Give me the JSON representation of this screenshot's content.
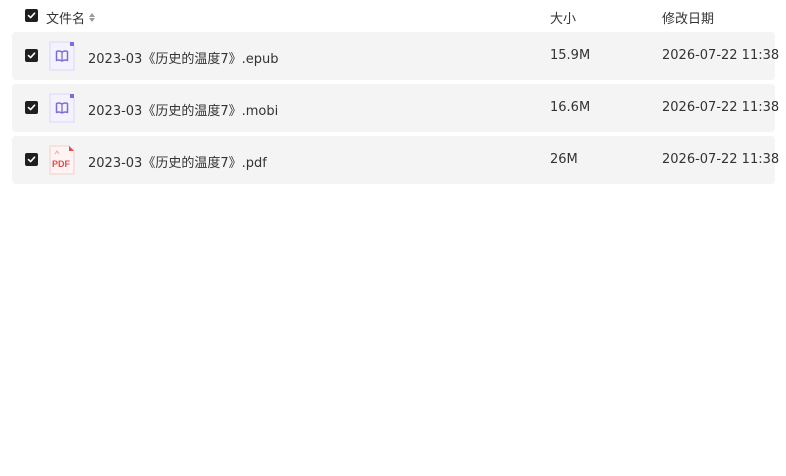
{
  "header": {
    "name_label": "文件名",
    "size_label": "大小",
    "date_label": "修改日期",
    "all_checked": true
  },
  "files": [
    {
      "name": "2023-03《历史的温度7》.epub",
      "size": "15.9M",
      "modified": "2026-07-22 11:38",
      "icon": "ebook-icon",
      "checked": true
    },
    {
      "name": "2023-03《历史的温度7》.mobi",
      "size": "16.6M",
      "modified": "2026-07-22 11:38",
      "icon": "ebook-icon",
      "checked": true
    },
    {
      "name": "2023-03《历史的温度7》.pdf",
      "size": "26M",
      "modified": "2026-07-22 11:38",
      "icon": "pdf-icon",
      "checked": true
    }
  ],
  "icons": {
    "pdf_text": "PDF"
  },
  "colors": {
    "row_bg": "#f4f4f4",
    "checkbox": "#1f1f1f",
    "ebook_accent": "#7b6fd6",
    "pdf_accent": "#e04b4b"
  }
}
